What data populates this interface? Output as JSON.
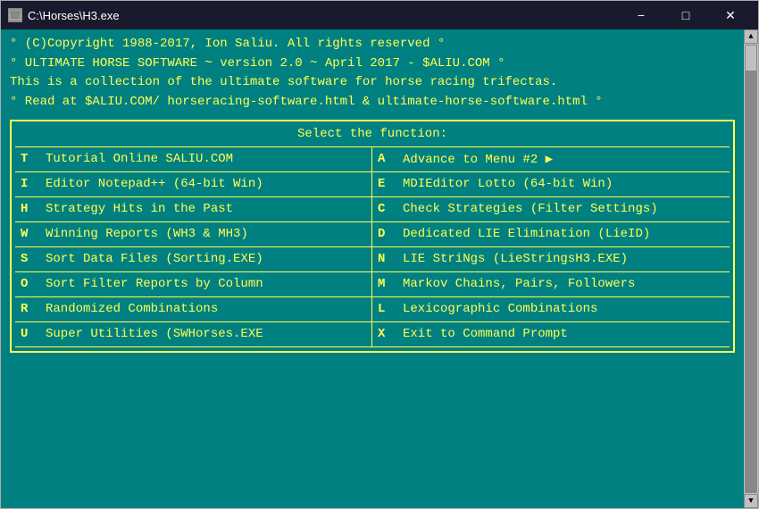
{
  "titleBar": {
    "icon": "▣",
    "title": "C:\\Horses\\H3.exe",
    "minimizeLabel": "−",
    "maximizeLabel": "□",
    "closeLabel": "✕"
  },
  "header": {
    "line1": "° (C)Copyright 1988-2017, Ion Saliu. All rights reserved                      °",
    "line2": "° ULTIMATE HORSE SOFTWARE ~ version 2.0 ~ April 2017 - $ALIU.COM             °",
    "line3": "  This is a collection of the ultimate software for horse racing trifectas.",
    "line4": "° Read at $ALIU.COM/ horseracing-software.html & ultimate-horse-software.html °"
  },
  "menu": {
    "title": "Select the function:",
    "items": [
      {
        "key": "T",
        "label": "Tutorial Online SALIU.COM",
        "side": "left"
      },
      {
        "key": "A",
        "label": "Advance to Menu #2 ▶",
        "side": "right"
      },
      {
        "key": "I",
        "label": "Editor Notepad++ (64-bit Win)",
        "side": "left"
      },
      {
        "key": "E",
        "label": "MDIEditor Lotto (64-bit Win)",
        "side": "right"
      },
      {
        "key": "H",
        "label": "Strategy Hits in the Past",
        "side": "left"
      },
      {
        "key": "C",
        "label": "Check Strategies (Filter Settings)",
        "side": "right"
      },
      {
        "key": "W",
        "label": "Winning Reports (WH3 & MH3)",
        "side": "left"
      },
      {
        "key": "D",
        "label": "Dedicated LIE Elimination (LieID)",
        "side": "right"
      },
      {
        "key": "S",
        "label": "Sort Data Files (Sorting.EXE)",
        "side": "left"
      },
      {
        "key": "N",
        "label": "LIE StriNgs (LieStringsH3.EXE)",
        "side": "right"
      },
      {
        "key": "O",
        "label": "Sort Filter Reports by Column",
        "side": "left"
      },
      {
        "key": "M",
        "label": "Markov Chains, Pairs, Followers",
        "side": "right"
      },
      {
        "key": "R",
        "label": "Randomized Combinations",
        "side": "left"
      },
      {
        "key": "L",
        "label": "Lexicographic Combinations",
        "side": "right"
      },
      {
        "key": "U",
        "label": "Super Utilities (SWHorses.EXE",
        "side": "left"
      },
      {
        "key": "X",
        "label": "Exit to Command Prompt",
        "side": "right"
      }
    ]
  }
}
